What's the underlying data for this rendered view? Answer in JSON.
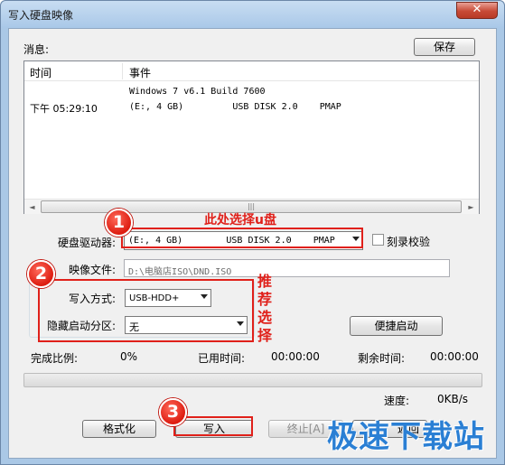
{
  "window": {
    "title": "写入硬盘映像",
    "close_glyph": "✕"
  },
  "messages": {
    "label": "消息:",
    "save_label": "保存",
    "columns": [
      "时间",
      "事件"
    ],
    "rows": [
      {
        "time": "",
        "event": "Windows 7 v6.1 Build 7600"
      },
      {
        "time": "下午 05:29:10",
        "event": "(E:, 4 GB)         USB DISK 2.0    PMAP"
      }
    ],
    "scroll_left": "◄",
    "scroll_right": "►",
    "scroll_grip": "|||"
  },
  "drive": {
    "label": "硬盘驱动器:",
    "value": "(E:, 4 GB)        USB DISK 2.0    PMAP",
    "verify_label": "刻录校验"
  },
  "image_file": {
    "label": "映像文件:",
    "value": "D:\\电脑店ISO\\DND.ISO"
  },
  "write_mode": {
    "label": "写入方式:",
    "value": "USB-HDD+"
  },
  "hidden_partition": {
    "label": "隐藏启动分区:",
    "value": "无"
  },
  "quick_boot_label": "便捷启动",
  "progress": {
    "complete_label": "完成比例:",
    "complete_value": "0%",
    "elapsed_label": "已用时间:",
    "elapsed_value": "00:00:00",
    "remaining_label": "剩余时间:",
    "remaining_value": "00:00:00",
    "fraction": 0
  },
  "speed": {
    "label": "速度:",
    "value": "0KB/s"
  },
  "buttons": {
    "format": "格式化",
    "write": "写入",
    "abort": "终止[A]",
    "back": "返回"
  },
  "annotations": {
    "badge1": "1",
    "badge2": "2",
    "badge3": "3",
    "select_udisk": "此处选择u盘",
    "recommend": [
      "推",
      "荐",
      "选",
      "择"
    ]
  },
  "watermark": "极速下载站",
  "colors": {
    "annotation_red": "#e0201a",
    "watermark_blue": "#2a7fd4",
    "titlebar": "#aac8e6"
  }
}
